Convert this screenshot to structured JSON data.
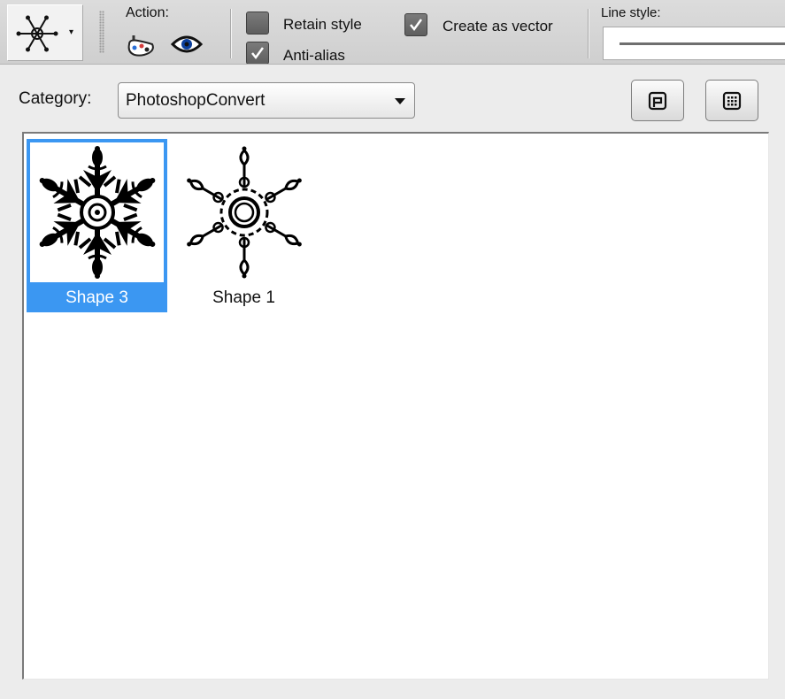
{
  "toolbar": {
    "shape_picker": {
      "icon": "snowflake-shape-icon",
      "dropdown_glyph": "▾"
    },
    "action": {
      "label": "Action:",
      "icons": [
        "paint-palette-icon",
        "eye-icon"
      ]
    },
    "options": {
      "retain_style": {
        "label": "Retain style",
        "checked": false
      },
      "anti_alias": {
        "label": "Anti-alias",
        "checked": true
      },
      "create_as_vector": {
        "label": "Create as vector",
        "checked": true
      }
    },
    "line_style": {
      "label": "Line style:"
    }
  },
  "category": {
    "label": "Category:",
    "selected": "PhotoshopConvert",
    "buttons": [
      "library-view-icon",
      "grid-view-icon"
    ]
  },
  "shapes": [
    {
      "name": "Shape 3",
      "selected": true,
      "style": "dense"
    },
    {
      "name": "Shape 1",
      "selected": false,
      "style": "outline"
    }
  ],
  "colors": {
    "selection": "#3b97f2",
    "toolbar": "#d5d5d5",
    "panel_bg": "#ececec"
  }
}
